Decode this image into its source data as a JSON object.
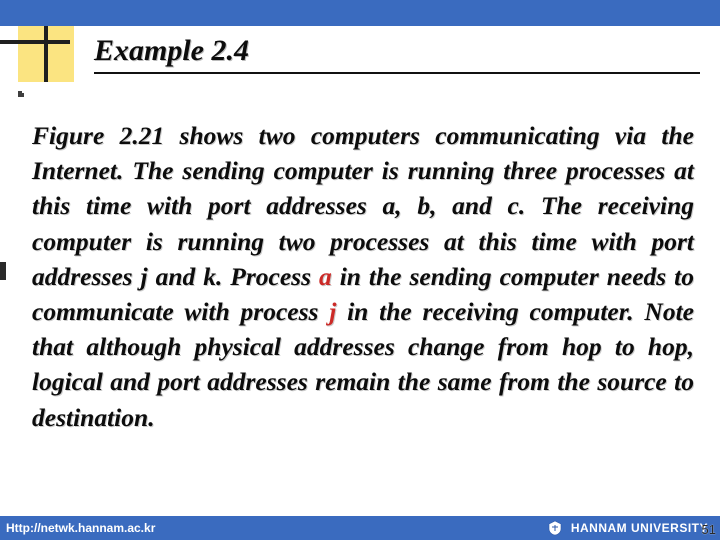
{
  "heading": "Example 2.4",
  "body": {
    "pre_a": "Figure 2.21 shows two computers communicating via the Internet. The sending computer is running three processes at this time with port addresses a, b, and c. The receiving computer is running two processes at this time with port addresses j and k. Process ",
    "a": "a",
    "mid": " in the sending computer needs to communicate with process ",
    "j": "j",
    "post_j": " in the receiving computer. Note that although physical addresses change from hop to hop, logical and port addresses remain the same from the source to destination."
  },
  "footer": {
    "left": "Http://netwk.hannam.ac.kr",
    "right": "HANNAM  UNIVERSITY"
  },
  "page_number": "51"
}
